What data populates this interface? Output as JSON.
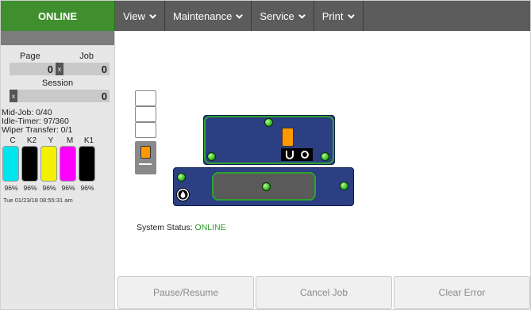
{
  "top": {
    "status": "ONLINE",
    "menus": [
      {
        "label": "View"
      },
      {
        "label": "Maintenance"
      },
      {
        "label": "Service"
      },
      {
        "label": "Print"
      }
    ]
  },
  "sidebar": {
    "page_label": "Page",
    "job_label": "Job",
    "page_value": "0",
    "x_symbol": "x",
    "job_value": "0",
    "session_label": "Session",
    "session_value": "0",
    "mid_job": "Mid-Job: 0/40",
    "idle_timer": "Idle-Timer: 97/360",
    "wiper_transfer": "Wiper Transfer: 0/1",
    "inks": [
      {
        "name": "C",
        "color": "#00e5ee",
        "pct": "96%"
      },
      {
        "name": "K2",
        "color": "#000000",
        "pct": "96%"
      },
      {
        "name": "Y",
        "color": "#f2f200",
        "pct": "96%"
      },
      {
        "name": "M",
        "color": "#ff00ff",
        "pct": "96%"
      },
      {
        "name": "K1",
        "color": "#000000",
        "pct": "96%"
      }
    ],
    "timestamp": "Tue 01/23/18 08:55:31 am"
  },
  "main": {
    "system_status_label": "System Status:",
    "system_status_value": "ONLINE",
    "buttons": {
      "pause_resume": "Pause/Resume",
      "cancel_job": "Cancel Job",
      "clear_error": "Clear Error"
    }
  },
  "colors": {
    "online_green": "#3f8f2f",
    "nav_bg": "#5c5c5c",
    "panel_blue": "#2b3f82",
    "led_green": "#4bd32e",
    "head_orange": "#ff9900"
  }
}
